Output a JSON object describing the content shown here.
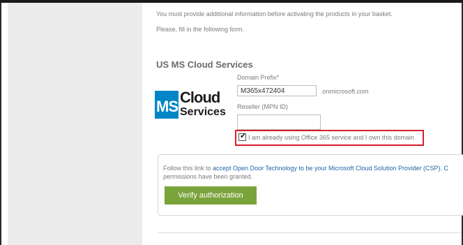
{
  "intro": {
    "line1": "You must provide additional information before activating the products in your basket.",
    "line2": "Please, fill in the following form."
  },
  "section": {
    "title": "US MS Cloud Services"
  },
  "logo": {
    "ms_letters": "MS",
    "word1": "Cloud",
    "word2": "Services",
    "colors": {
      "blue": "#0086c7",
      "green": "#7cc04b"
    }
  },
  "form": {
    "domain_prefix_label": "Domain Prefix*",
    "domain_prefix_value": "M365x472404",
    "domain_suffix": ".onmicrosoft.com",
    "reseller_label": "Reseller (MPN ID)",
    "reseller_value": "",
    "own_domain_checked": true,
    "own_domain_label": "I am already using Office 365 service and I own this domain"
  },
  "authorization": {
    "follow_prefix": "Follow this link to ",
    "follow_link": "accept Open Door Technology to be your Microsoft Cloud Solution Provider (CSP). C",
    "granted_text": "permissions have been granted.",
    "verify_button": "Verify authorization"
  },
  "colors": {
    "highlight": "#d71e2a",
    "button": "#7ba33c",
    "link": "#1f65a8"
  }
}
